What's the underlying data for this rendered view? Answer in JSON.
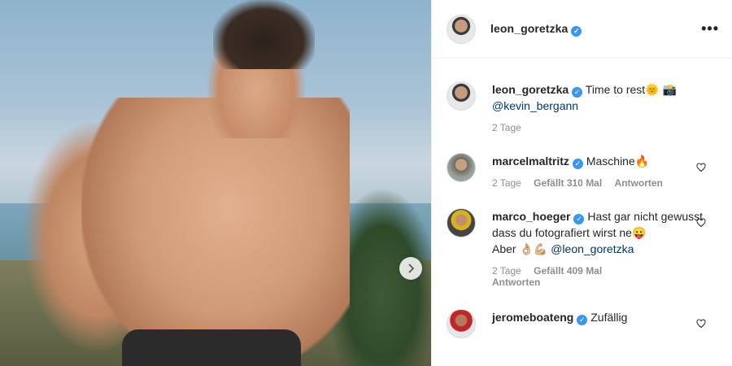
{
  "post_author": {
    "username": "leon_goretzka",
    "verified": true
  },
  "header": {
    "more_label": "•••"
  },
  "caption": {
    "username": "leon_goretzka",
    "text": "Time to rest",
    "emojis": "🌞 📸",
    "mention": "@kevin_bergann",
    "time": "2 Tage"
  },
  "comments": [
    {
      "username": "marcelmaltritz",
      "text": "Maschine🔥",
      "time": "2 Tage",
      "likes": "Gefällt 310 Mal",
      "reply": "Antworten"
    },
    {
      "username": "marco_hoeger",
      "text": "Hast gar nicht gewusst dass du fotografiert wirst ne😛",
      "line2_prefix": "Aber 👌🏼💪🏼",
      "mention": "@leon_goretzka",
      "time": "2 Tage",
      "likes": "Gefällt 409 Mal",
      "reply": "Antworten"
    },
    {
      "username": "jeromeboateng",
      "text": "Zufällig"
    }
  ],
  "colors": {
    "accent": "#3897f0",
    "mention": "#00376b",
    "muted": "#8e8e8e"
  }
}
